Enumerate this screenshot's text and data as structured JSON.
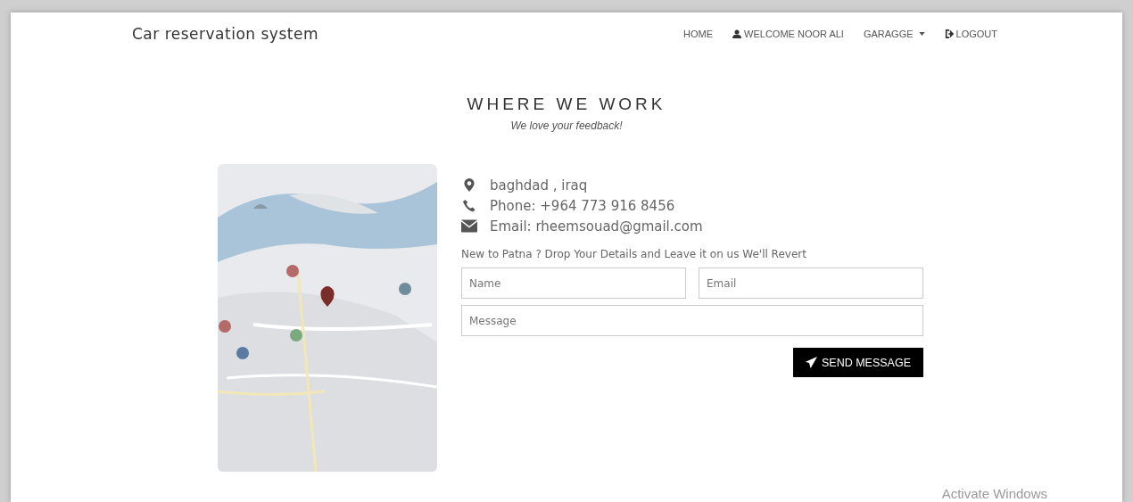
{
  "navbar": {
    "brand": "Car reservation system",
    "items": [
      {
        "label": "HOME",
        "kind": "plain",
        "dropdown": false
      },
      {
        "label": "WELCOME NOOR ALI",
        "kind": "user",
        "dropdown": false
      },
      {
        "label": "GARAGGE",
        "kind": "plain",
        "dropdown": true
      },
      {
        "label": "LOGOUT",
        "kind": "logout",
        "dropdown": false
      }
    ]
  },
  "section": {
    "title": "WHERE WE WORK",
    "subtitle": "We love your feedback!"
  },
  "contact": [
    {
      "kind": "location",
      "text": "baghdad , iraq"
    },
    {
      "kind": "phone",
      "text": "Phone: +964 773 916 8456"
    },
    {
      "kind": "email",
      "text": "Email: rheemsouad@gmail.com"
    }
  ],
  "form": {
    "intro": "New to Patna ? Drop Your Details and Leave it on us We'll Revert",
    "name": {
      "placeholder": "Name"
    },
    "email": {
      "placeholder": "Email"
    },
    "message": {
      "placeholder": "Message"
    },
    "submit": "SEND MESSAGE"
  },
  "os_notice": "Activate Windows"
}
